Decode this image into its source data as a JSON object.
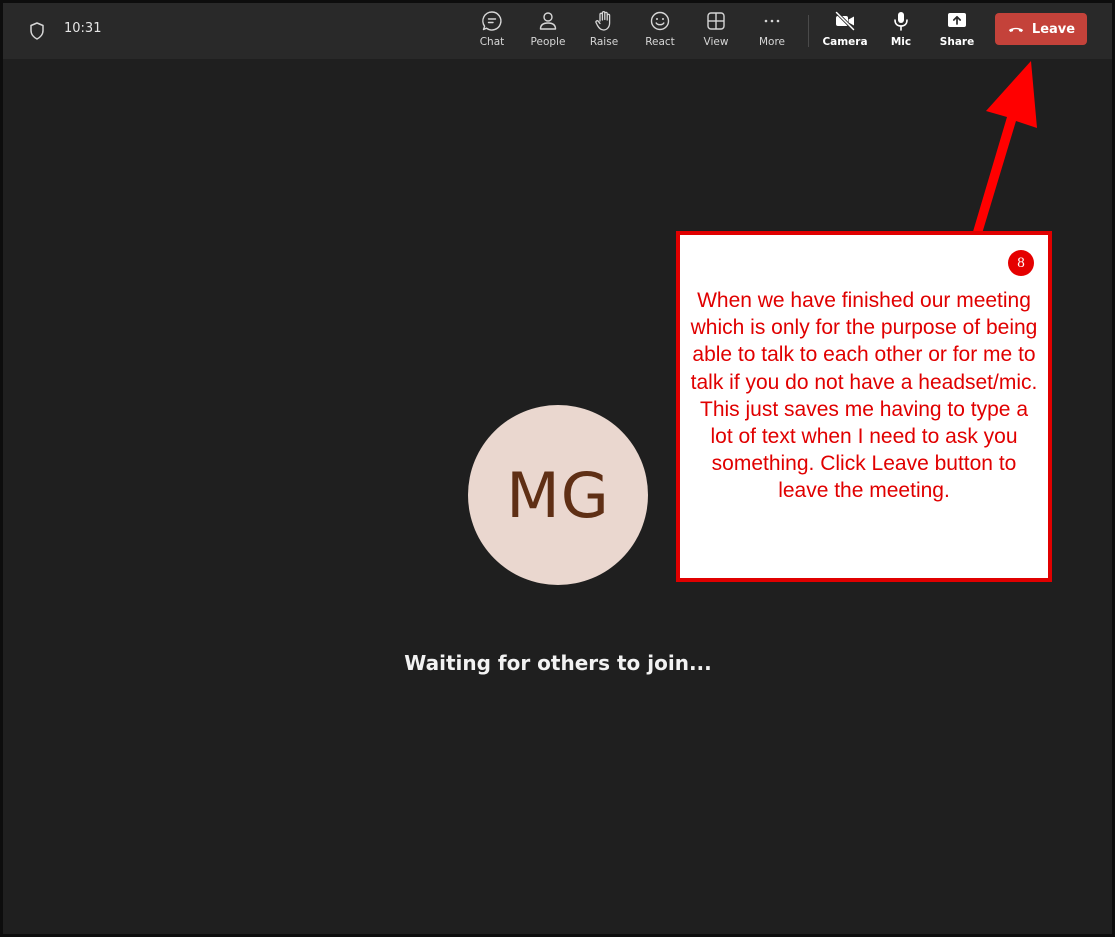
{
  "topbar": {
    "time": "10:31",
    "tools": [
      {
        "name": "chat",
        "label": "Chat",
        "icon": "chat-icon"
      },
      {
        "name": "people",
        "label": "People",
        "icon": "people-icon"
      },
      {
        "name": "raise",
        "label": "Raise",
        "icon": "hand-icon"
      },
      {
        "name": "react",
        "label": "React",
        "icon": "smiley-icon"
      },
      {
        "name": "view",
        "label": "View",
        "icon": "grid-icon"
      },
      {
        "name": "more",
        "label": "More",
        "icon": "ellipsis-icon"
      },
      {
        "name": "camera",
        "label": "Camera",
        "icon": "camera-off-icon"
      },
      {
        "name": "mic",
        "label": "Mic",
        "icon": "mic-icon"
      },
      {
        "name": "share",
        "label": "Share",
        "icon": "share-icon"
      }
    ],
    "leave_label": "Leave"
  },
  "stage": {
    "avatar_initials": "MG",
    "status": "Waiting for others to join..."
  },
  "callout": {
    "step": "8",
    "text": "When we have finished our meeting which is only for the purpose of being able to talk to each other or for me to talk if you do not have a headset/mic. This just saves me having to type a lot of text when I need to ask you something. Click Leave button to leave the meeting."
  },
  "colors": {
    "background": "#1f1f1f",
    "topbar": "#292929",
    "leave_button": "#c4423a",
    "annotation": "#e00000",
    "avatar_bg": "#ead7cf",
    "avatar_text": "#5f2f15"
  }
}
